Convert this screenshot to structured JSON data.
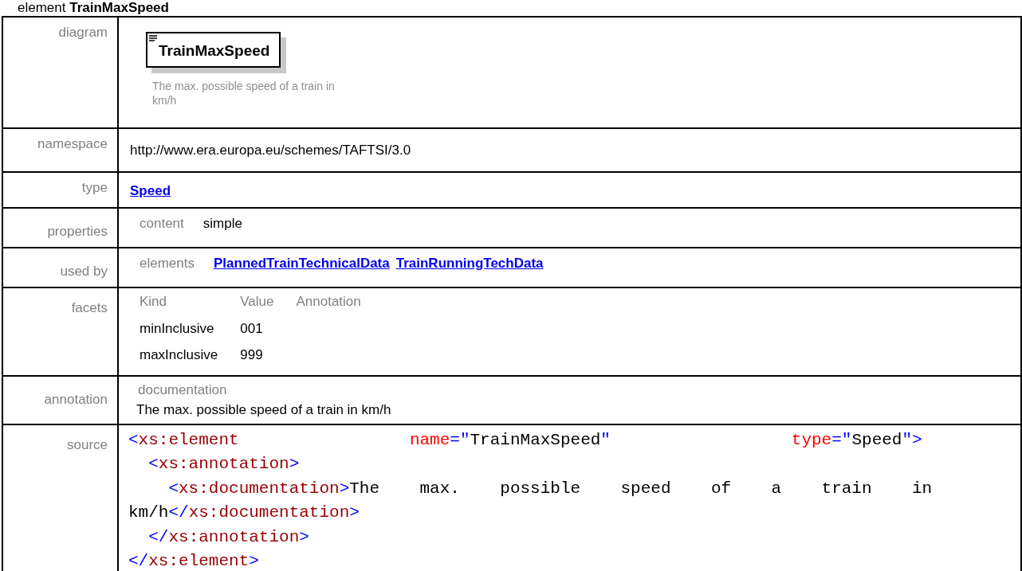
{
  "heading": {
    "kind_label": "element",
    "name": "TrainMaxSpeed"
  },
  "rows": [
    {
      "kind": "diagram",
      "label": "diagram",
      "node": {
        "name": "TrainMaxSpeed",
        "description": "The max. possible speed of a train in km/h"
      }
    },
    {
      "kind": "text",
      "label": "namespace",
      "value": "http://www.era.europa.eu/schemes/TAFTSI/3.0"
    },
    {
      "kind": "links",
      "label": "type",
      "links": [
        "Speed"
      ]
    },
    {
      "kind": "props",
      "label": "properties",
      "pairs": [
        {
          "key": "content",
          "value": "simple"
        }
      ]
    },
    {
      "kind": "usedby",
      "label": "used by",
      "group": "elements",
      "links": [
        "PlannedTrainTechnicalData",
        "TrainRunningTechData"
      ]
    },
    {
      "kind": "facets",
      "label": "facets",
      "columns": [
        "Kind",
        "Value",
        "Annotation"
      ],
      "items": [
        [
          "minInclusive",
          "001"
        ],
        [
          "maxInclusive",
          "999"
        ]
      ]
    },
    {
      "kind": "annotation",
      "label": "annotation",
      "title": "documentation",
      "text": "The max. possible speed of a train in km/h"
    },
    {
      "kind": "source",
      "label": "source",
      "lines": [
        [
          {
            "kind": "punct",
            "s": "<"
          },
          {
            "kind": "tag",
            "s": "xs:element"
          },
          {
            "kind": "attr",
            "s": "                 name"
          },
          {
            "kind": "punct",
            "s": "=\""
          },
          {
            "kind": "val",
            "s": "TrainMaxSpeed"
          },
          {
            "kind": "punct",
            "s": "\""
          },
          {
            "kind": "attr",
            "s": "                  type"
          },
          {
            "kind": "punct",
            "s": "=\""
          },
          {
            "kind": "val",
            "s": "Speed"
          },
          {
            "kind": "punct",
            "s": "\">"
          }
        ],
        [
          {
            "kind": "punct",
            "s": "  <"
          },
          {
            "kind": "tag",
            "s": "xs:annotation"
          },
          {
            "kind": "punct",
            "s": ">"
          }
        ],
        [
          {
            "kind": "punct",
            "s": "    <"
          },
          {
            "kind": "tag",
            "s": "xs:documentation"
          },
          {
            "kind": "punct",
            "s": ">"
          },
          {
            "kind": "val",
            "s": "The    max.    possible    speed    of    a    train    in"
          }
        ],
        [
          {
            "kind": "val",
            "s": "km/h"
          },
          {
            "kind": "punct",
            "s": "</"
          },
          {
            "kind": "tag",
            "s": "xs:documentation"
          },
          {
            "kind": "punct",
            "s": ">"
          }
        ],
        [
          {
            "kind": "punct",
            "s": "  </"
          },
          {
            "kind": "tag",
            "s": "xs:annotation"
          },
          {
            "kind": "punct",
            "s": ">"
          }
        ],
        [
          {
            "kind": "punct",
            "s": "</"
          },
          {
            "kind": "tag",
            "s": "xs:element"
          },
          {
            "kind": "punct",
            "s": ">"
          }
        ]
      ]
    }
  ]
}
